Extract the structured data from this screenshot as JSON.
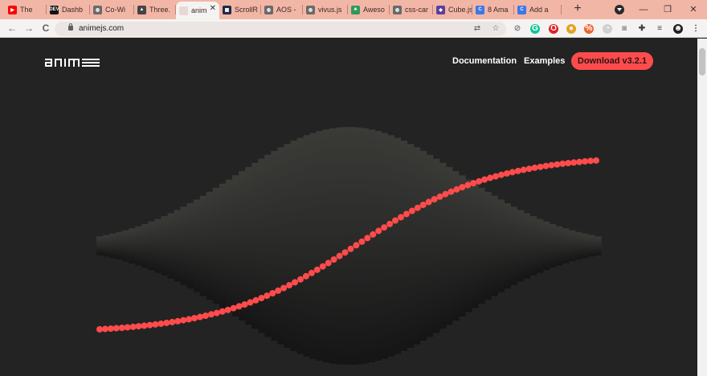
{
  "browser": {
    "tabs": [
      {
        "label": "The",
        "favicon": "youtube-icon",
        "color": "#ff0000",
        "glyph": "▶"
      },
      {
        "label": "Dashb",
        "favicon": "dev-icon",
        "color": "#111111",
        "glyph": "DEV"
      },
      {
        "label": "Co-Wi",
        "favicon": "globe-icon",
        "color": "#6a6a6a",
        "glyph": "◍"
      },
      {
        "label": "Three.",
        "favicon": "threejs-icon",
        "color": "#444444",
        "glyph": "▲"
      },
      {
        "label": "anim",
        "favicon": "animejs-icon",
        "color": "#e8d8d4",
        "glyph": ""
      },
      {
        "label": "ScrollR",
        "favicon": "scrollreveal-icon",
        "color": "#1d2b4a",
        "glyph": "▦"
      },
      {
        "label": "AOS -",
        "favicon": "globe-icon",
        "color": "#6a6a6a",
        "glyph": "◍"
      },
      {
        "label": "vivus.js",
        "favicon": "globe-icon",
        "color": "#6a6a6a",
        "glyph": "◍"
      },
      {
        "label": "Aweso",
        "favicon": "awesome-icon",
        "color": "#2e9a5a",
        "glyph": "♣"
      },
      {
        "label": "css-car",
        "favicon": "globe-icon",
        "color": "#6a6a6a",
        "glyph": "◍"
      },
      {
        "label": "Cube.js",
        "favicon": "cubejs-icon",
        "color": "#5b3ea0",
        "glyph": "◆"
      },
      {
        "label": "8 Ama",
        "favicon": "chrome-store-icon",
        "color": "#3b78e7",
        "glyph": "C"
      },
      {
        "label": "Add a",
        "favicon": "chrome-store-icon",
        "color": "#3b78e7",
        "glyph": "C"
      }
    ],
    "new_tab_glyph": "+",
    "window_controls": {
      "minimize": "—",
      "restore": "❐",
      "close": "✕"
    },
    "nav": {
      "back": "←",
      "forward": "→",
      "reload": "C"
    },
    "url": "animejs.com",
    "omnibox_icons": {
      "translate": "⇄",
      "bookmark": "☆"
    },
    "extensions": [
      {
        "name": "block-icon",
        "color": "#8a8a8a",
        "glyph": "⊘"
      },
      {
        "name": "grammarly-icon",
        "color": "#15c39a",
        "glyph": "G"
      },
      {
        "name": "opera-icon",
        "color": "#e02020",
        "glyph": "O"
      },
      {
        "name": "colorpick-icon",
        "color": "#e8a020",
        "glyph": "●"
      },
      {
        "name": "wappalyzer-icon",
        "color": "#f06030",
        "glyph": "%"
      },
      {
        "name": "clock-icon",
        "color": "#d0d0d0",
        "glyph": "◔"
      },
      {
        "name": "camera-icon",
        "color": "#9a9a9a",
        "glyph": "◙"
      },
      {
        "name": "puzzle-icon",
        "color": "#444444",
        "glyph": "✚"
      },
      {
        "name": "playlist-icon",
        "color": "#444444",
        "glyph": "≡"
      },
      {
        "name": "avatar-icon",
        "color": "#222222",
        "glyph": "☻"
      },
      {
        "name": "menu-icon",
        "color": "#444444",
        "glyph": "⋮"
      }
    ]
  },
  "site": {
    "nav_links": [
      "Documentation",
      "Examples"
    ],
    "download_label": "Download v3.2.1",
    "accent": "#ff4b4b",
    "background": "#232323"
  }
}
